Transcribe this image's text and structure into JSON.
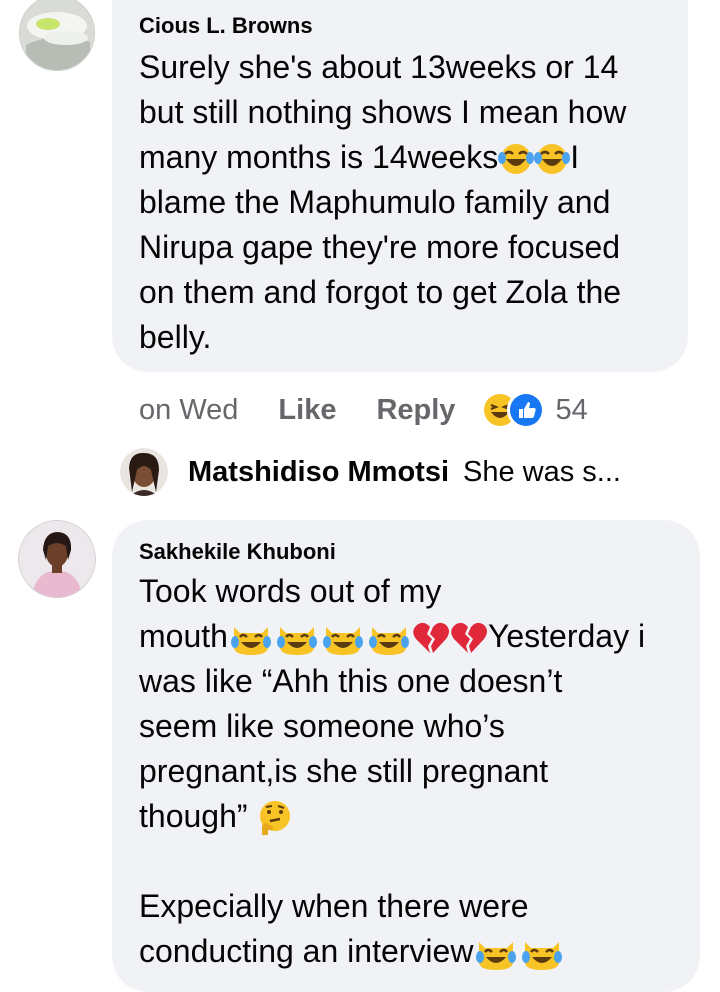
{
  "comments": [
    {
      "author": "Cious L. Browns",
      "lines": [
        "Surely she's about 13weeks or 14",
        "but still nothing shows I mean how",
        "many months is 14weeks",
        "I",
        "blame the Maphumulo family and",
        "Nirupa gape they're more focused",
        "on them and forgot to get Zola the",
        "belly."
      ],
      "emoji": [
        "face-with-tears-of-joy-icon",
        "face-with-tears-of-joy-icon"
      ],
      "actions": {
        "time": "on Wed",
        "like": "Like",
        "reply": "Reply",
        "reaction_count": "54",
        "reactions": [
          "haha-reaction-icon",
          "like-reaction-icon"
        ]
      },
      "reply_preview": {
        "name": "Matshidiso Mmotsi",
        "snippet": "She was s..."
      }
    },
    {
      "author": "Sakhekile Khuboni",
      "lines": [
        "Took words out of my",
        "mouth",
        "Yesterday i",
        "was like “Ahh this one doesn’t",
        "seem like someone who’s",
        "pregnant,is she still pregnant",
        "though”",
        "Expecially when there were",
        "conducting an interview"
      ],
      "emoji": [
        "cat-with-tears-of-joy-icon",
        "broken-heart-icon",
        "thinking-face-icon"
      ]
    }
  ],
  "colors": {
    "bubble": "#f0f2f5",
    "secondary_text": "#65676b",
    "like_blue": "#1877f2",
    "emoji_yellow": "#f7c325",
    "broken_heart": "#e0283a"
  }
}
